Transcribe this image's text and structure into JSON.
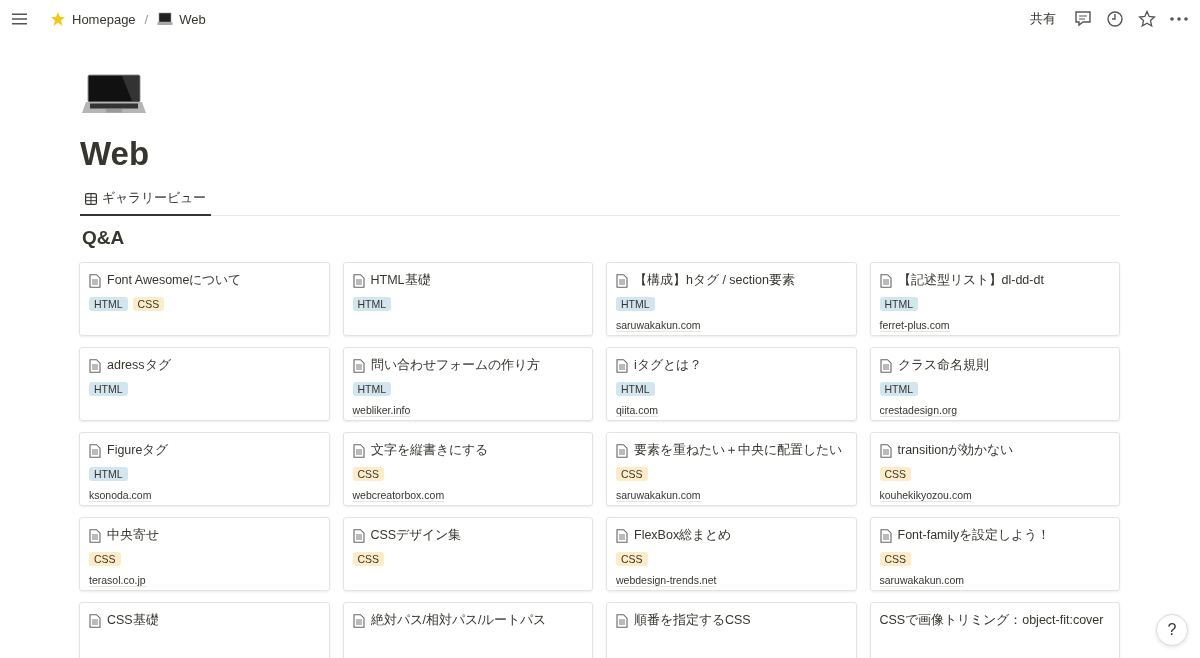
{
  "topbar": {
    "breadcrumbs": [
      {
        "label": "Homepage"
      },
      {
        "label": "Web"
      }
    ],
    "separator": "/",
    "share": "共有"
  },
  "page": {
    "title": "Web",
    "views": [
      {
        "label": "ギャラリービュー",
        "selected": true
      }
    ],
    "group": "Q&A"
  },
  "cards": [
    {
      "title": "Font Awesomeについて",
      "icon": true,
      "tags": [
        {
          "label": "HTML",
          "color": "#d3e5ef"
        },
        {
          "label": "CSS",
          "color": "#fdecc8"
        }
      ]
    },
    {
      "title": "HTML基礎",
      "icon": true,
      "tags": [
        {
          "label": "HTML",
          "color": "#d3e5ef"
        }
      ]
    },
    {
      "title": "【構成】hタグ / section要素",
      "icon": true,
      "tags": [
        {
          "label": "HTML",
          "color": "#d3e5ef"
        }
      ],
      "source": "saruwakakun.com"
    },
    {
      "title": "【記述型リスト】dl-dd-dt",
      "icon": true,
      "tags": [
        {
          "label": "HTML",
          "color": "#d3e5ef"
        }
      ],
      "source": "ferret-plus.com"
    },
    {
      "title": "adressタグ",
      "icon": true,
      "tags": [
        {
          "label": "HTML",
          "color": "#d3e5ef"
        }
      ]
    },
    {
      "title": "問い合わせフォームの作り方",
      "icon": true,
      "tags": [
        {
          "label": "HTML",
          "color": "#d3e5ef"
        }
      ],
      "source": "webliker.info"
    },
    {
      "title": "iタグとは？",
      "icon": true,
      "tags": [
        {
          "label": "HTML",
          "color": "#d3e5ef"
        }
      ],
      "source": "qiita.com"
    },
    {
      "title": "クラス命名規則",
      "icon": true,
      "tags": [
        {
          "label": "HTML",
          "color": "#d3e5ef"
        }
      ],
      "source": "crestadesign.org"
    },
    {
      "title": "Figureタグ",
      "icon": true,
      "tags": [
        {
          "label": "HTML",
          "color": "#d3e5ef"
        }
      ],
      "source": "ksonoda.com"
    },
    {
      "title": "文字を縦書きにする",
      "icon": true,
      "tags": [
        {
          "label": "CSS",
          "color": "#fdecc8"
        }
      ],
      "source": "webcreatorbox.com"
    },
    {
      "title": "要素を重ねたい＋中央に配置したい",
      "icon": true,
      "tags": [
        {
          "label": "CSS",
          "color": "#fdecc8"
        }
      ],
      "source": "saruwakakun.com"
    },
    {
      "title": "transitionが効かない",
      "icon": true,
      "tags": [
        {
          "label": "CSS",
          "color": "#fdecc8"
        }
      ],
      "source": "kouhekikyozou.com"
    },
    {
      "title": "中央寄せ",
      "icon": true,
      "tags": [
        {
          "label": "CSS",
          "color": "#fdecc8"
        }
      ],
      "source": "terasol.co.jp"
    },
    {
      "title": "CSSデザイン集",
      "icon": true,
      "tags": [
        {
          "label": "CSS",
          "color": "#fdecc8"
        }
      ]
    },
    {
      "title": "FlexBox総まとめ",
      "icon": true,
      "tags": [
        {
          "label": "CSS",
          "color": "#fdecc8"
        }
      ],
      "source": "webdesign-trends.net"
    },
    {
      "title": "Font-familyを設定しよう！",
      "icon": true,
      "tags": [
        {
          "label": "CSS",
          "color": "#fdecc8"
        }
      ],
      "source": "saruwakakun.com"
    },
    {
      "title": "CSS基礎",
      "icon": true
    },
    {
      "title": "絶対パス/相対パス/ルートパス",
      "icon": true
    },
    {
      "title": "順番を指定するCSS",
      "icon": true
    },
    {
      "title": "CSSで画像トリミング：object-fit:cover",
      "icon": false
    }
  ],
  "help": "?"
}
